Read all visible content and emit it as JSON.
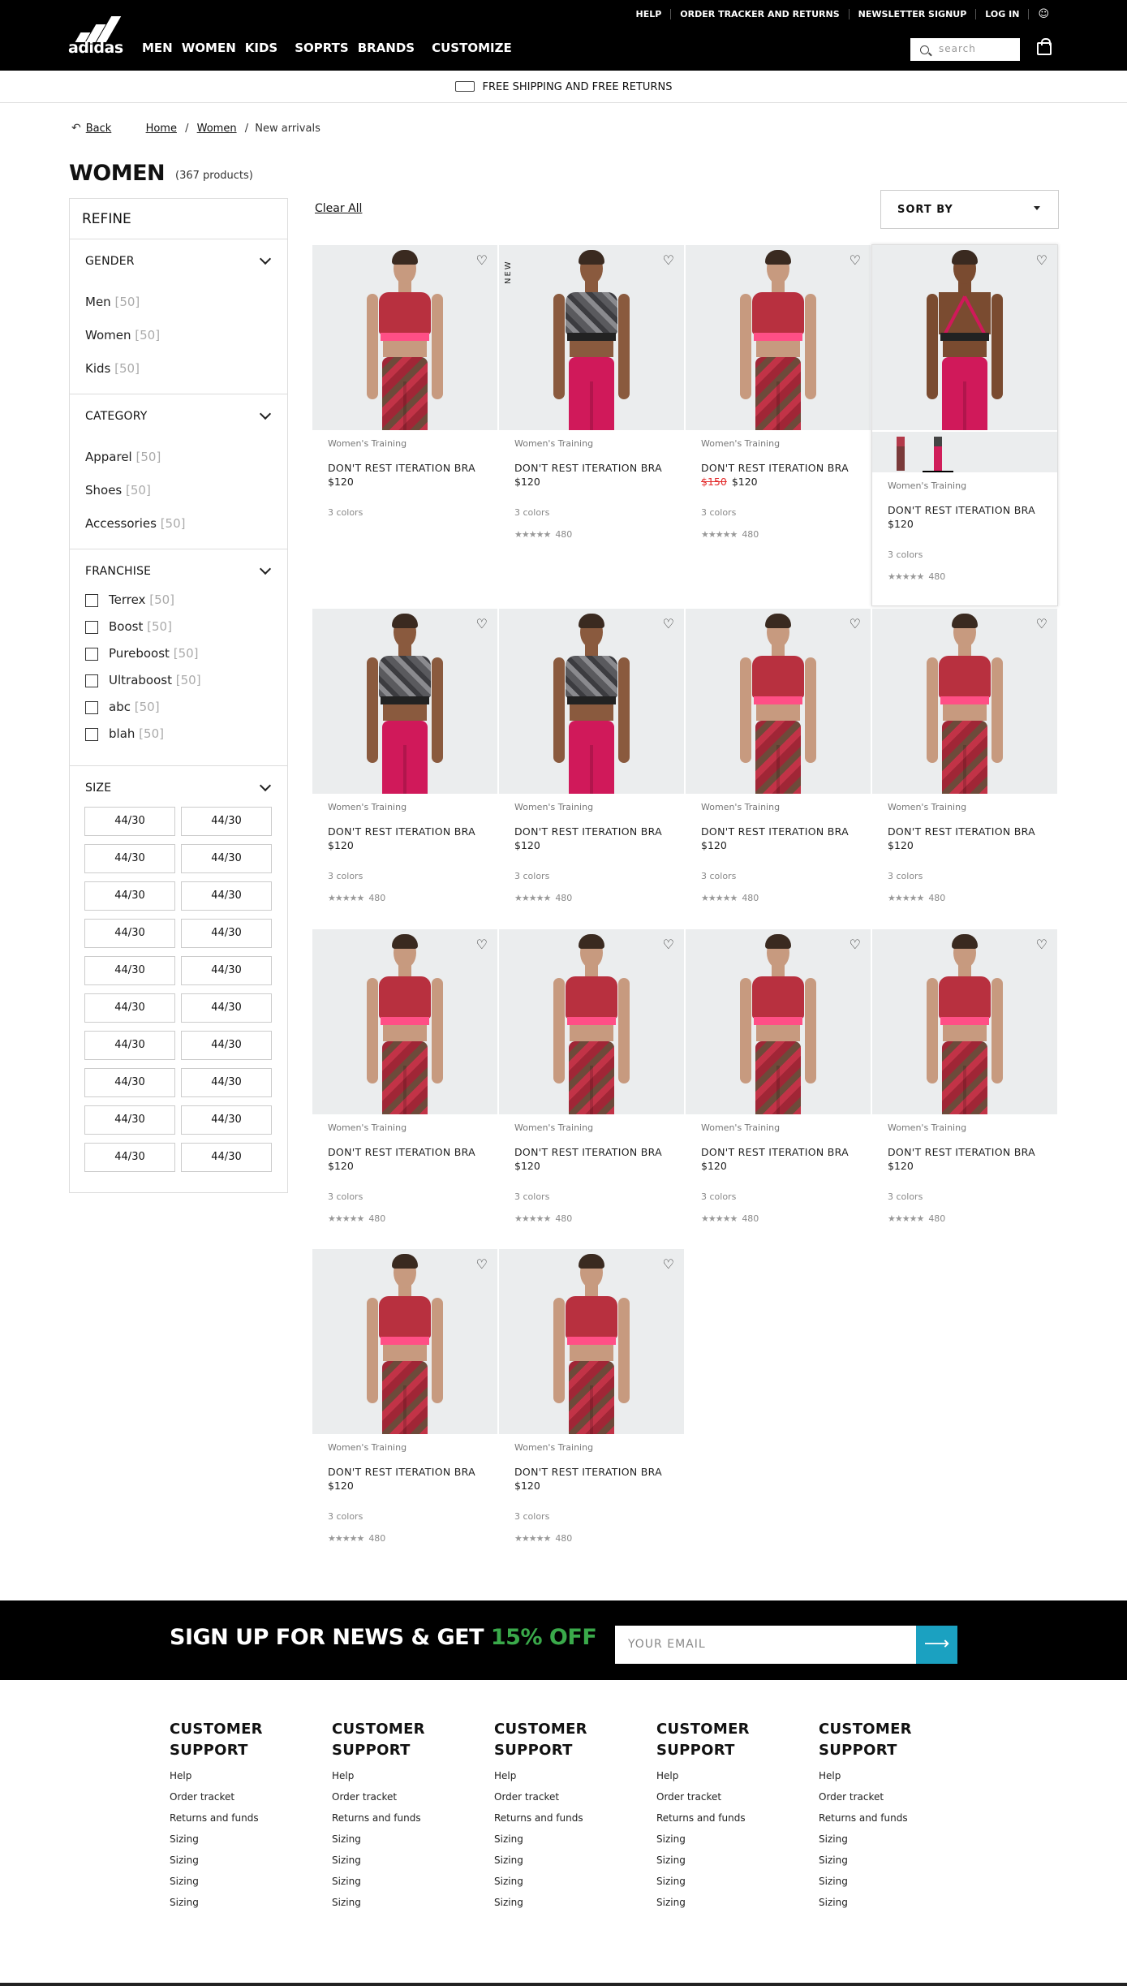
{
  "header": {
    "util_links": [
      "HELP",
      "ORDER TRACKER AND RETURNS",
      "NEWSLETTER SIGNUP",
      "LOG IN"
    ],
    "logo_text": "adidas",
    "nav": [
      "MEN",
      "WOMEN",
      "KIDS",
      "SOPRTS",
      "BRANDS",
      "CUSTOMIZE"
    ],
    "search_placeholder": "search"
  },
  "shipping_banner": "FREE SHIPPING AND FREE RETURNS",
  "breadcrumb": {
    "back": "Back",
    "items": [
      "Home",
      "Women"
    ],
    "current": "New arrivals",
    "separator": "/"
  },
  "page_title": "WOMEN",
  "product_count": "(367 products)",
  "filters": {
    "refine": "REFINE",
    "gender": {
      "title": "GENDER",
      "items": [
        {
          "label": "Men",
          "count": "[50]"
        },
        {
          "label": "Women",
          "count": "[50]"
        },
        {
          "label": "Kids",
          "count": "[50]"
        }
      ]
    },
    "category": {
      "title": "CATEGORY",
      "items": [
        {
          "label": "Apparel",
          "count": "[50]"
        },
        {
          "label": "Shoes",
          "count": "[50]"
        },
        {
          "label": "Accessories",
          "count": "[50]"
        }
      ]
    },
    "franchise": {
      "title": "FRANCHISE",
      "items": [
        {
          "label": "Terrex",
          "count": "[50]"
        },
        {
          "label": "Boost",
          "count": "[50]"
        },
        {
          "label": "Pureboost",
          "count": "[50]"
        },
        {
          "label": "Ultraboost",
          "count": "[50]"
        },
        {
          "label": "abc",
          "count": "[50]"
        },
        {
          "label": "blah",
          "count": "[50]"
        }
      ]
    },
    "size": {
      "title": "SIZE",
      "values": [
        "44/30",
        "44/30",
        "44/30",
        "44/30",
        "44/30",
        "44/30",
        "44/30",
        "44/30",
        "44/30",
        "44/30",
        "44/30",
        "44/30",
        "44/30",
        "44/30",
        "44/30",
        "44/30",
        "44/30",
        "44/30",
        "44/30",
        "44/30"
      ]
    }
  },
  "toolbar": {
    "clear_all": "Clear All",
    "sort_by": "SORT BY"
  },
  "products": [
    {
      "category": "Women's Training",
      "name": "DON'T REST ITERATION BRA",
      "price": "$120",
      "old_price": "",
      "colors": "3 colors",
      "reviews": "",
      "variant": "front",
      "tag": ""
    },
    {
      "category": "Women's Training",
      "name": "DON'T REST ITERATION BRA",
      "price": "$120",
      "old_price": "",
      "colors": "3 colors",
      "reviews": "480",
      "variant": "camo",
      "tag": "NEW"
    },
    {
      "category": "Women's Training",
      "name": "DON'T REST ITERATION BRA",
      "price": "$120",
      "old_price": "$150",
      "colors": "3 colors",
      "reviews": "480",
      "variant": "front",
      "tag": ""
    },
    {
      "category": "Women's Training",
      "name": "DON'T REST ITERATION BRA",
      "price": "$120",
      "old_price": "",
      "colors": "3 colors",
      "reviews": "480",
      "variant": "back",
      "tag": ""
    },
    {
      "category": "Women's Training",
      "name": "DON'T REST ITERATION BRA",
      "price": "$120",
      "old_price": "",
      "colors": "3 colors",
      "reviews": "480",
      "variant": "camo",
      "tag": ""
    },
    {
      "category": "Women's Training",
      "name": "DON'T REST ITERATION BRA",
      "price": "$120",
      "old_price": "",
      "colors": "3 colors",
      "reviews": "480",
      "variant": "camo",
      "tag": ""
    },
    {
      "category": "Women's Training",
      "name": "DON'T REST ITERATION BRA",
      "price": "$120",
      "old_price": "",
      "colors": "3 colors",
      "reviews": "480",
      "variant": "front",
      "tag": ""
    },
    {
      "category": "Women's Training",
      "name": "DON'T REST ITERATION BRA",
      "price": "$120",
      "old_price": "",
      "colors": "3 colors",
      "reviews": "480",
      "variant": "front",
      "tag": ""
    },
    {
      "category": "Women's Training",
      "name": "DON'T REST ITERATION BRA",
      "price": "$120",
      "old_price": "",
      "colors": "3 colors",
      "reviews": "480",
      "variant": "front",
      "tag": ""
    },
    {
      "category": "Women's Training",
      "name": "DON'T REST ITERATION BRA",
      "price": "$120",
      "old_price": "",
      "colors": "3 colors",
      "reviews": "480",
      "variant": "front",
      "tag": ""
    },
    {
      "category": "Women's Training",
      "name": "DON'T REST ITERATION BRA",
      "price": "$120",
      "old_price": "",
      "colors": "3 colors",
      "reviews": "480",
      "variant": "front",
      "tag": ""
    },
    {
      "category": "Women's Training",
      "name": "DON'T REST ITERATION BRA",
      "price": "$120",
      "old_price": "",
      "colors": "3 colors",
      "reviews": "480",
      "variant": "front",
      "tag": ""
    },
    {
      "category": "Women's Training",
      "name": "DON'T REST ITERATION BRA",
      "price": "$120",
      "old_price": "",
      "colors": "3 colors",
      "reviews": "480",
      "variant": "front",
      "tag": ""
    },
    {
      "category": "Women's Training",
      "name": "DON'T REST ITERATION BRA",
      "price": "$120",
      "old_price": "",
      "colors": "3 colors",
      "reviews": "480",
      "variant": "front",
      "tag": ""
    }
  ],
  "rating_stars": "★★★★★",
  "newsletter": {
    "text": "SIGN UP FOR NEWS & GET ",
    "highlight": "15% OFF",
    "placeholder": "YOUR EMAIL",
    "highlight_color": "#3aa94a",
    "button_color": "#1ba1c1"
  },
  "footer": {
    "columns": [
      {
        "title": "CUSTOMER SUPPORT",
        "links": [
          "Help",
          "Order tracket",
          "Returns and funds",
          "Sizing",
          "Sizing",
          "Sizing",
          "Sizing"
        ]
      },
      {
        "title": "CUSTOMER SUPPORT",
        "links": [
          "Help",
          "Order tracket",
          "Returns and funds",
          "Sizing",
          "Sizing",
          "Sizing",
          "Sizing"
        ]
      },
      {
        "title": "CUSTOMER SUPPORT",
        "links": [
          "Help",
          "Order tracket",
          "Returns and funds",
          "Sizing",
          "Sizing",
          "Sizing",
          "Sizing"
        ]
      },
      {
        "title": "CUSTOMER SUPPORT",
        "links": [
          "Help",
          "Order tracket",
          "Returns and funds",
          "Sizing",
          "Sizing",
          "Sizing",
          "Sizing"
        ]
      },
      {
        "title": "CUSTOMER SUPPORT",
        "links": [
          "Help",
          "Order tracket",
          "Returns and funds",
          "Sizing",
          "Sizing",
          "Sizing",
          "Sizing"
        ]
      }
    ]
  }
}
